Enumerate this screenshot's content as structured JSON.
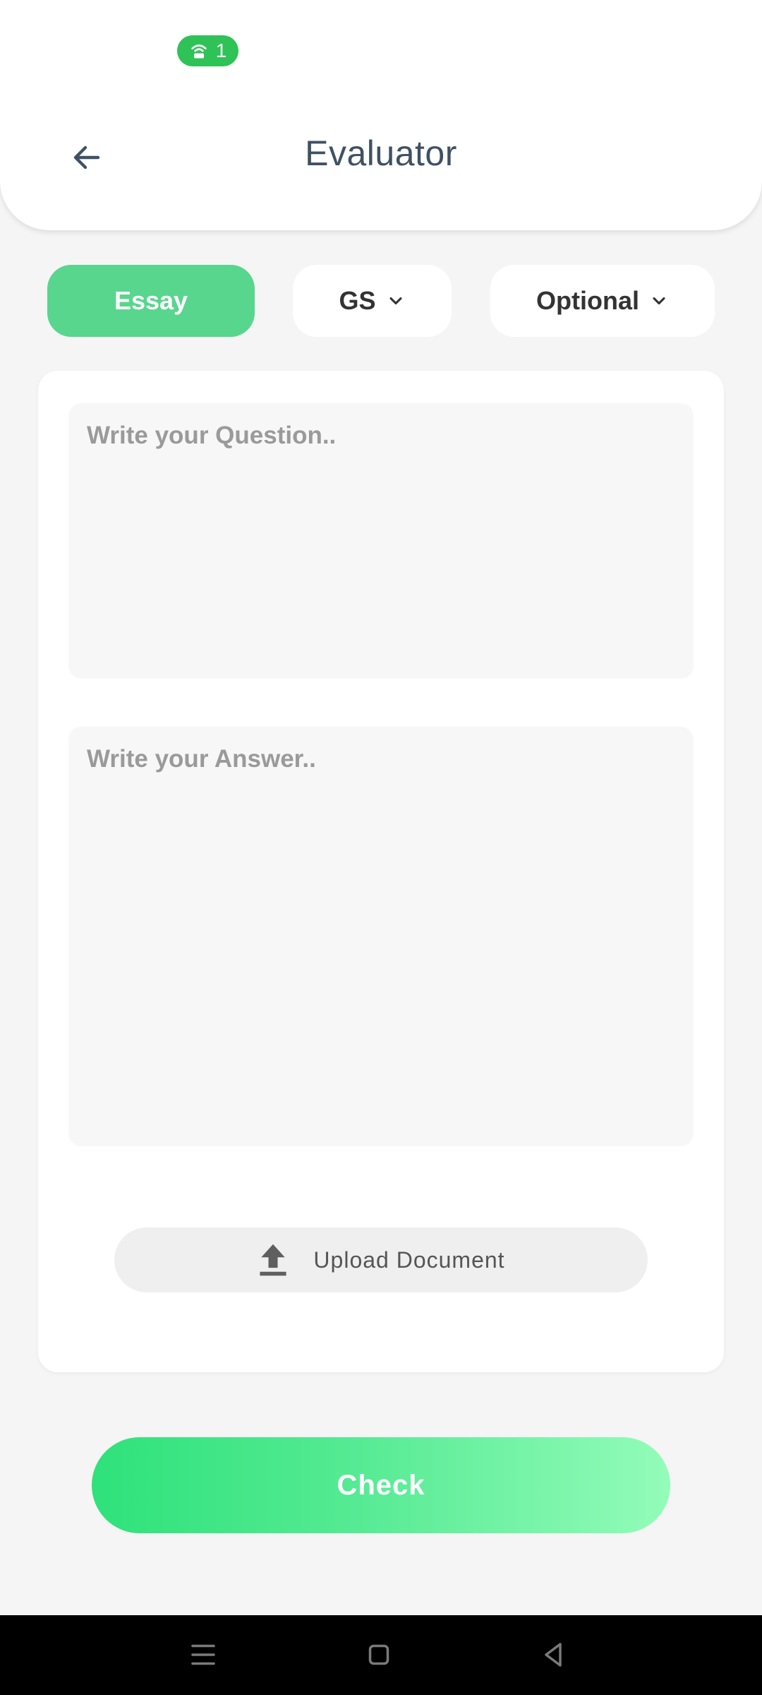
{
  "status_bar": {
    "hotspot_count": "1",
    "hotspot_icon": "hotspot-icon"
  },
  "header": {
    "title": "Evaluator",
    "back_icon": "arrow-left-icon"
  },
  "tabs": [
    {
      "label": "Essay",
      "selected": true
    },
    {
      "label": "GS",
      "selected": false,
      "icon": "chevron-down-icon"
    },
    {
      "label": "Optional",
      "selected": false,
      "icon": "chevron-down-icon"
    }
  ],
  "form": {
    "question_placeholder": "Write your Question..",
    "question_value": "",
    "answer_placeholder": "Write your Answer..",
    "answer_value": "",
    "upload_label": "Upload Document",
    "upload_icon": "upload-icon"
  },
  "actions": {
    "check_label": "Check"
  },
  "navbar": {
    "icons": [
      "menu-icon",
      "home-icon",
      "back-icon"
    ]
  },
  "colors": {
    "accent": "#58d68d",
    "hotspot": "#2fc257",
    "check_gradient_start": "#2ee27a",
    "check_gradient_end": "#93fcb9",
    "title": "#3f5163",
    "background": "#f5f5f5"
  }
}
